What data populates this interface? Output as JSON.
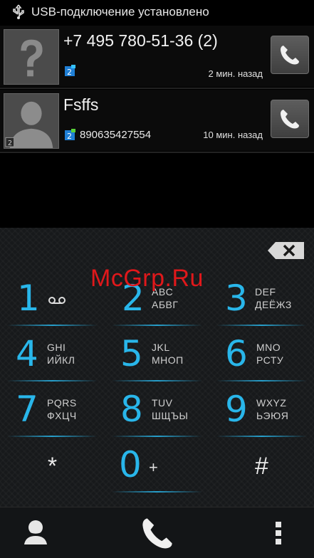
{
  "status_bar": {
    "icon": "usb-icon",
    "text": "USB-подключение установлено"
  },
  "call_log": [
    {
      "name": "+7 495 780-51-36 (2)",
      "number": "",
      "time": "2 мин. назад",
      "avatar": "unknown-contact-icon",
      "sim": "2"
    },
    {
      "name": "Fsffs",
      "number": "890635427554",
      "time": "10 мин. назад",
      "avatar": "contact-silhouette-icon",
      "sim": "2"
    }
  ],
  "dialpad": {
    "keys": [
      {
        "digit": "1",
        "latin": "",
        "cyrillic": "",
        "icon": "voicemail-icon"
      },
      {
        "digit": "2",
        "latin": "ABC",
        "cyrillic": "АБВГ"
      },
      {
        "digit": "3",
        "latin": "DEF",
        "cyrillic": "ДЕЁЖЗ"
      },
      {
        "digit": "4",
        "latin": "GHI",
        "cyrillic": "ИЙКЛ"
      },
      {
        "digit": "5",
        "latin": "JKL",
        "cyrillic": "МНОП"
      },
      {
        "digit": "6",
        "latin": "MNO",
        "cyrillic": "РСТУ"
      },
      {
        "digit": "7",
        "latin": "PQRS",
        "cyrillic": "ФХЦЧ"
      },
      {
        "digit": "8",
        "latin": "TUV",
        "cyrillic": "ШЩЪЫ"
      },
      {
        "digit": "9",
        "latin": "WXYZ",
        "cyrillic": "ЬЭЮЯ"
      },
      {
        "digit": "*"
      },
      {
        "digit": "0",
        "extra": "+"
      },
      {
        "digit": "#"
      }
    ]
  },
  "watermark": "McGrp.Ru",
  "colors": {
    "accent": "#29b6ea",
    "watermark": "#e0181b"
  }
}
